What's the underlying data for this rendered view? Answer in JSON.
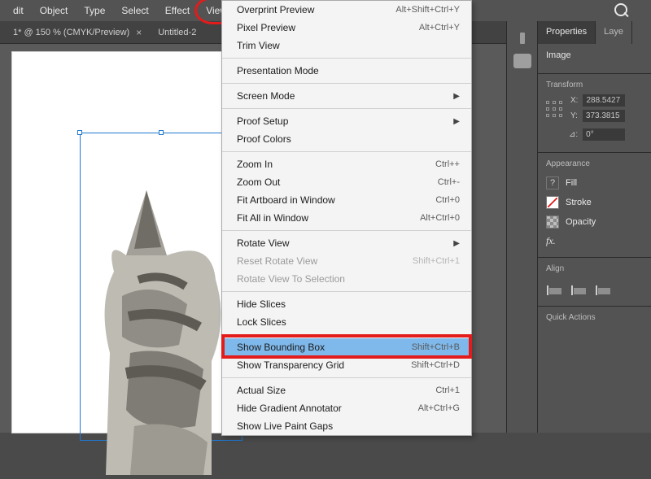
{
  "menubar": {
    "items": [
      "dit",
      "Object",
      "Type",
      "Select",
      "Effect",
      "View"
    ],
    "active_index": 5
  },
  "tabs": {
    "doc1": "1* @ 150 % (CMYK/Preview)",
    "doc2": "Untitled-2"
  },
  "dropdown": {
    "groups": [
      [
        {
          "label": "Overprint Preview",
          "shortcut": "Alt+Shift+Ctrl+Y"
        },
        {
          "label": "Pixel Preview",
          "shortcut": "Alt+Ctrl+Y"
        },
        {
          "label": "Trim View",
          "shortcut": ""
        }
      ],
      [
        {
          "label": "Presentation Mode",
          "shortcut": ""
        }
      ],
      [
        {
          "label": "Screen Mode",
          "submenu": true
        }
      ],
      [
        {
          "label": "Proof Setup",
          "submenu": true
        },
        {
          "label": "Proof Colors",
          "shortcut": ""
        }
      ],
      [
        {
          "label": "Zoom In",
          "shortcut": "Ctrl++"
        },
        {
          "label": "Zoom Out",
          "shortcut": "Ctrl+-"
        },
        {
          "label": "Fit Artboard in Window",
          "shortcut": "Ctrl+0"
        },
        {
          "label": "Fit All in Window",
          "shortcut": "Alt+Ctrl+0"
        }
      ],
      [
        {
          "label": "Rotate View",
          "submenu": true
        },
        {
          "label": "Reset Rotate View",
          "shortcut": "Shift+Ctrl+1",
          "disabled": true
        },
        {
          "label": "Rotate View To Selection",
          "shortcut": "",
          "disabled": true
        }
      ],
      [
        {
          "label": "Hide Slices",
          "shortcut": ""
        },
        {
          "label": "Lock Slices",
          "shortcut": ""
        }
      ],
      [
        {
          "label": "Show Bounding Box",
          "shortcut": "Shift+Ctrl+B",
          "hilite": true
        },
        {
          "label": "Show Transparency Grid",
          "shortcut": "Shift+Ctrl+D"
        }
      ],
      [
        {
          "label": "Actual Size",
          "shortcut": "Ctrl+1"
        },
        {
          "label": "Hide Gradient Annotator",
          "shortcut": "Alt+Ctrl+G"
        },
        {
          "label": "Show Live Paint Gaps",
          "shortcut": ""
        }
      ]
    ]
  },
  "panels": {
    "tab1": "Properties",
    "tab2": "Laye",
    "current": "Image",
    "transform_label": "Transform",
    "x_label": "X:",
    "y_label": "Y:",
    "angle_label": "⊿:",
    "x_value": "288.5427",
    "y_value": "373.3815",
    "angle_value": "0°",
    "appearance_label": "Appearance",
    "fill_label": "Fill",
    "stroke_label": "Stroke",
    "opacity_label": "Opacity",
    "fx_label": "fx.",
    "align_label": "Align",
    "quick_label": "Quick Actions"
  }
}
